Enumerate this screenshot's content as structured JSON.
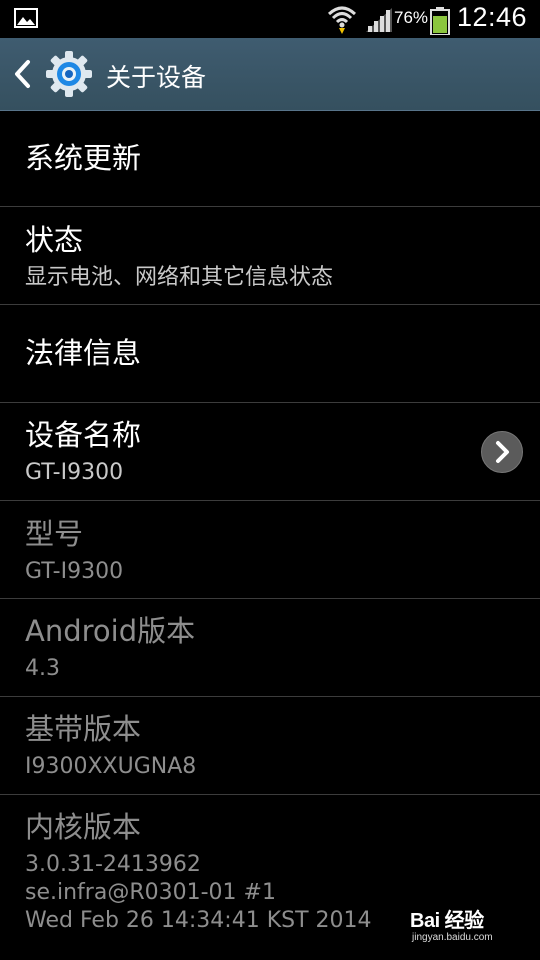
{
  "status_bar": {
    "battery_percent": "76%",
    "time": "12:46",
    "icons": [
      "image-icon",
      "wifi-icon",
      "signal-icon",
      "battery-icon"
    ]
  },
  "action_bar": {
    "title": "关于设备",
    "icons": [
      "back-icon",
      "settings-gear-icon"
    ]
  },
  "list": {
    "items": [
      {
        "title": "系统更新",
        "subtitle": ""
      },
      {
        "title": "状态",
        "subtitle": "显示电池、网络和其它信息状态"
      },
      {
        "title": "法律信息",
        "subtitle": ""
      },
      {
        "title": "设备名称",
        "subtitle": "GT-I9300"
      },
      {
        "title": "型号",
        "subtitle": "GT-I9300"
      },
      {
        "title": "Android版本",
        "subtitle": "4.3"
      },
      {
        "title": "基带版本",
        "subtitle": "I9300XXUGNA8"
      },
      {
        "title": "内核版本",
        "subtitle_lines": [
          "3.0.31-2413962",
          "se.infra@R0301-01 #1",
          "Wed Feb 26 14:34:41 KST 2014"
        ]
      }
    ]
  },
  "watermark": {
    "logo": "Bai 经验",
    "url": "jingyan.baidu.com"
  },
  "colors": {
    "action_bar": "#3f5c70",
    "background": "#000000",
    "disabled_text": "#8e8e8e",
    "battery": "#8cc63f"
  }
}
